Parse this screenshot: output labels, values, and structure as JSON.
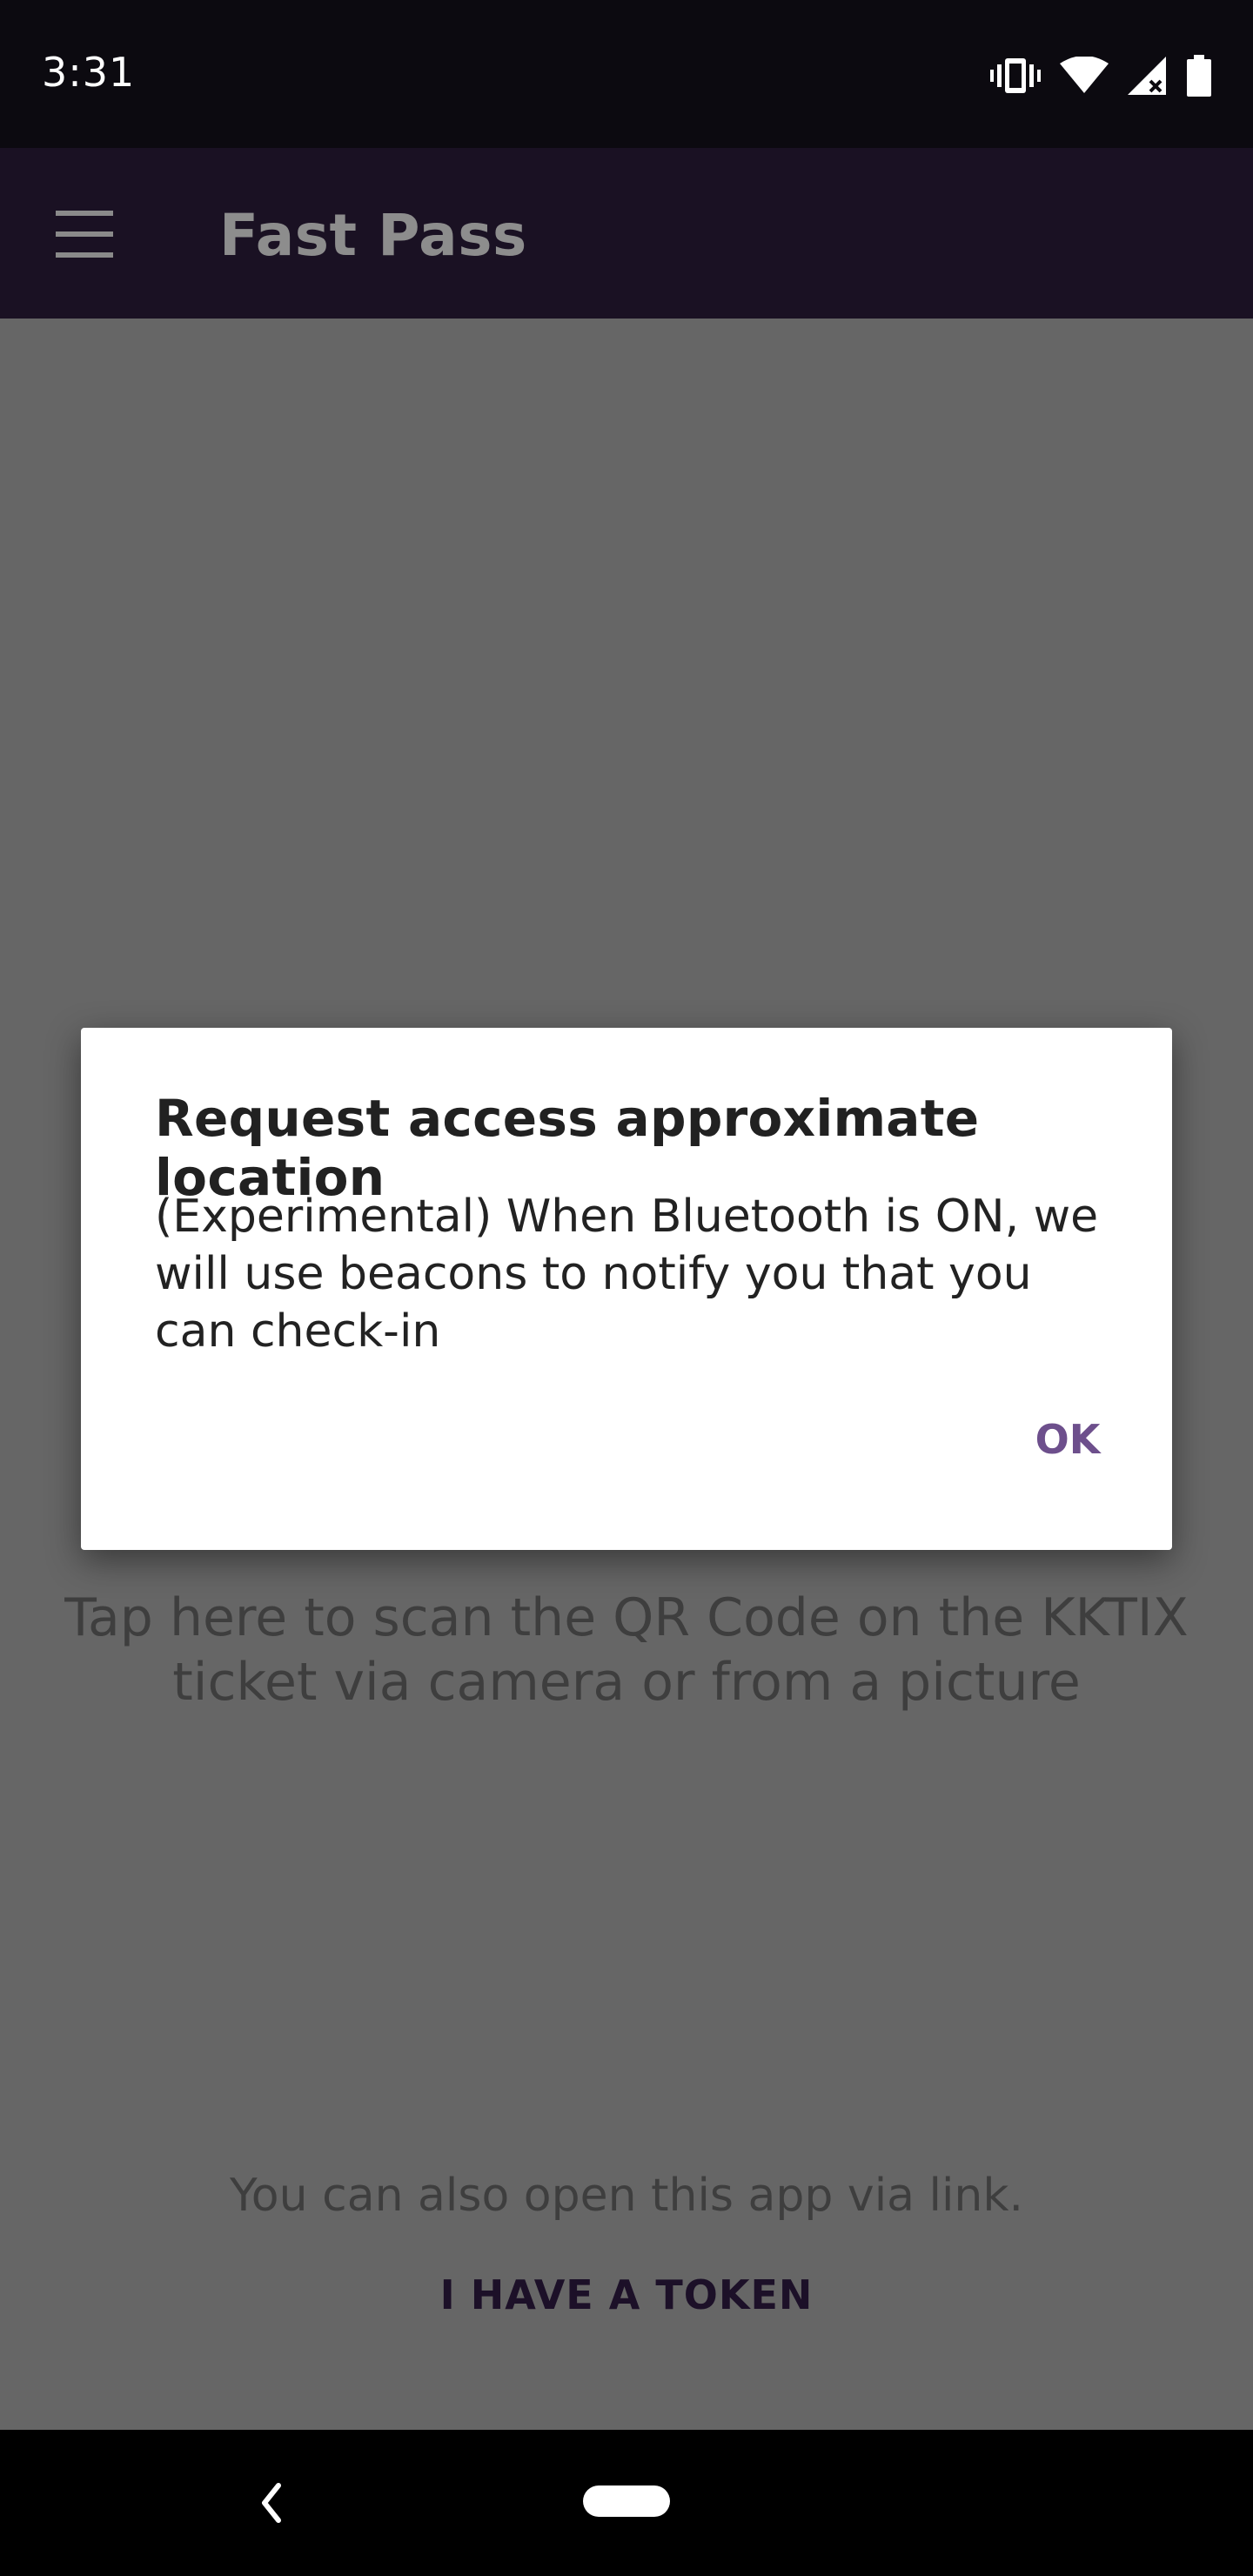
{
  "status_bar": {
    "time": "3:31",
    "icons": [
      "vibrate-icon",
      "wifi-icon",
      "cellular-no-signal-icon",
      "battery-icon"
    ]
  },
  "app_bar": {
    "menu_icon": "hamburger-menu-icon",
    "title": "Fast Pass"
  },
  "content": {
    "scan_hint": "Tap here to scan the QR Code on the KKTIX ticket via camera or from a picture",
    "link_hint": "You can also open this app via link.",
    "token_button": "I HAVE A TOKEN"
  },
  "dialog": {
    "title": "Request access approximate location",
    "message": "(Experimental) When Bluetooth is ON, we will use beacons to notify you that you can check-in",
    "ok_label": "OK"
  },
  "nav_bar": {
    "icons": [
      "back-icon",
      "home-pill-icon"
    ]
  },
  "colors": {
    "app_bar": "#1a1123",
    "scrim": "#666666",
    "accent": "#6d4f8c",
    "status_bar": "#0c0a10"
  }
}
